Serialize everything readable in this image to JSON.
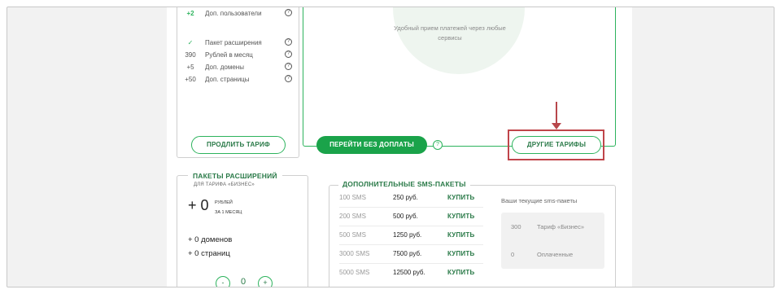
{
  "tariff_features": [
    {
      "value": "+2",
      "label": "Доп. пользователи",
      "green": false
    },
    {
      "value": "✓",
      "label": "Пакет расширения",
      "green": true
    },
    {
      "value": "390",
      "label": "Рублей в месяц",
      "green": false
    },
    {
      "value": "+5",
      "label": "Доп. домены",
      "green": false
    },
    {
      "value": "+50",
      "label": "Доп. страницы",
      "green": false
    }
  ],
  "help_glyph": "?",
  "buttons": {
    "extend": "ПРОДЛИТЬ ТАРИФ",
    "switch_free": "ПЕРЕЙТИ БЕЗ ДОПЛАТЫ",
    "other_tariffs": "ДРУГИЕ ТАРИФЫ"
  },
  "promo_text": "Удобный прием платежей через любые сервисы",
  "extensions": {
    "title": "ПАКЕТЫ РАСШИРЕНИЙ",
    "subtitle": "ДЛЯ ТАРИФА «БИЗНЕС»",
    "price": "+ 0",
    "price_unit_1": "РУБЛЕЙ",
    "price_unit_2": "ЗА 1 МЕСЯЦ",
    "domains": "+ 0 доменов",
    "pages": "+ 0 страниц",
    "stepper": {
      "minus": "-",
      "value": "0",
      "plus": "+"
    }
  },
  "sms": {
    "title": "ДОПОЛНИТЕЛЬНЫЕ SMS-ПАКЕТЫ",
    "rows": [
      {
        "amount": "100 SMS",
        "price": "250 руб.",
        "action": "КУПИТЬ"
      },
      {
        "amount": "200 SMS",
        "price": "500 руб.",
        "action": "КУПИТЬ"
      },
      {
        "amount": "500 SMS",
        "price": "1250 руб.",
        "action": "КУПИТЬ"
      },
      {
        "amount": "3000 SMS",
        "price": "7500 руб.",
        "action": "КУПИТЬ"
      },
      {
        "amount": "5000 SMS",
        "price": "12500 руб.",
        "action": "КУПИТЬ"
      }
    ],
    "current_title": "Ваши текущие sms-пакеты",
    "current": [
      {
        "count": "300",
        "label": "Тариф «Бизнес»"
      },
      {
        "count": "0",
        "label": "Оплаченные"
      }
    ]
  },
  "colors": {
    "accent": "#2db35d",
    "accent_dark": "#2a7a48",
    "highlight": "#c0454a"
  }
}
